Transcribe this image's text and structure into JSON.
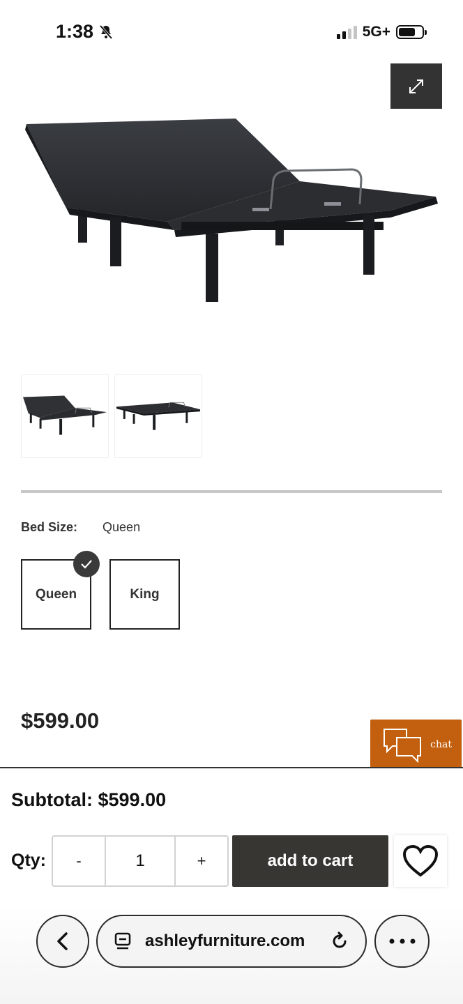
{
  "status_bar": {
    "time": "1:38",
    "network": "5G+",
    "battery_level": 0.72,
    "signal_bars_active": 2,
    "signal_bars_total": 4
  },
  "product": {
    "image_alt": "Adjustable bed base",
    "thumbnails": [
      "Adjustable base raised",
      "Adjustable base flat"
    ]
  },
  "options": {
    "label": "Bed Size:",
    "selected_value": "Queen",
    "sizes": [
      {
        "label": "Queen",
        "selected": true
      },
      {
        "label": "King",
        "selected": false
      }
    ]
  },
  "price": "$599.00",
  "chat": {
    "label": "chat",
    "color": "#c2600f"
  },
  "purchase": {
    "subtotal_label": "Subtotal:",
    "subtotal_value": "$599.00",
    "qty_label": "Qty:",
    "qty_minus": "-",
    "qty_value": "1",
    "qty_plus": "+",
    "add_to_cart": "add to cart"
  },
  "browser": {
    "url": "ashleyfurniture.com"
  },
  "icons": {
    "expand": "expand-icon",
    "check": "check-icon",
    "chat": "chat-bubbles-icon",
    "heart": "heart-icon",
    "back": "chevron-left-icon",
    "tab": "tab-icon",
    "reload": "reload-icon",
    "more": "more-dots-icon",
    "mute": "bell-slash-icon"
  }
}
